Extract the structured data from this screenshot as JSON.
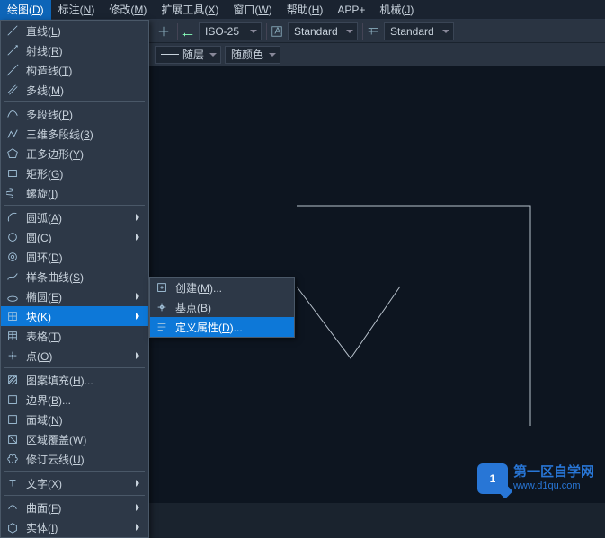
{
  "menubar": [
    {
      "label": "绘图",
      "key": "D",
      "active": true
    },
    {
      "label": "标注",
      "key": "N"
    },
    {
      "label": "修改",
      "key": "M"
    },
    {
      "label": "扩展工具",
      "key": "X"
    },
    {
      "label": "窗口",
      "key": "W"
    },
    {
      "label": "帮助",
      "key": "H"
    },
    {
      "label": "APP+",
      "key": ""
    },
    {
      "label": "机械",
      "key": "J"
    }
  ],
  "toolbar1": {
    "sel1": "ISO-25",
    "sel2": "Standard",
    "sel3": "Standard"
  },
  "toolbar2": {
    "sel1": "随层",
    "sel2": "随颜色"
  },
  "draw_menu": [
    {
      "icon": "line",
      "label": "直线",
      "sk": "L"
    },
    {
      "icon": "ray",
      "label": "射线",
      "sk": "R"
    },
    {
      "icon": "xline",
      "label": "构造线",
      "sk": "T"
    },
    {
      "icon": "mline",
      "label": "多线",
      "sk": "M"
    },
    {
      "sep": true
    },
    {
      "icon": "pline",
      "label": "多段线",
      "sk": "P"
    },
    {
      "icon": "3dpoly",
      "label": "三维多段线",
      "sk": "3"
    },
    {
      "icon": "polygon",
      "label": "正多边形",
      "sk": "Y"
    },
    {
      "icon": "rect",
      "label": "矩形",
      "sk": "G"
    },
    {
      "icon": "helix",
      "label": "螺旋",
      "sk": "I"
    },
    {
      "sep": true
    },
    {
      "icon": "arc",
      "label": "圆弧",
      "sk": "A",
      "sub": true
    },
    {
      "icon": "circle",
      "label": "圆",
      "sk": "C",
      "sub": true
    },
    {
      "icon": "donut",
      "label": "圆环",
      "sk": "D"
    },
    {
      "icon": "spline",
      "label": "样条曲线",
      "sk": "S"
    },
    {
      "icon": "ellipse",
      "label": "椭圆",
      "sk": "E",
      "sub": true
    },
    {
      "icon": "block",
      "label": "块",
      "sk": "K",
      "sub": true,
      "hl": true
    },
    {
      "icon": "table",
      "label": "表格",
      "sk": "T"
    },
    {
      "icon": "point",
      "label": "点",
      "sk": "O",
      "sub": true
    },
    {
      "sep": true
    },
    {
      "icon": "hatch",
      "label": "图案填充",
      "sk": "H",
      "dots": true
    },
    {
      "icon": "boundary",
      "label": "边界",
      "sk": "B",
      "dots": true
    },
    {
      "icon": "region",
      "label": "面域",
      "sk": "N"
    },
    {
      "icon": "wipeout",
      "label": "区域覆盖",
      "sk": "W"
    },
    {
      "icon": "revcloud",
      "label": "修订云线",
      "sk": "U"
    },
    {
      "sep": true
    },
    {
      "icon": "text",
      "label": "文字",
      "sk": "X",
      "sub": true
    },
    {
      "sep": true
    },
    {
      "icon": "surface",
      "label": "曲面",
      "sk": "F",
      "sub": true
    },
    {
      "icon": "solid",
      "label": "实体",
      "sk": "I",
      "sub": true
    }
  ],
  "block_submenu": [
    {
      "icon": "make",
      "label": "创建",
      "sk": "M",
      "dots": true
    },
    {
      "icon": "base",
      "label": "基点",
      "sk": "B"
    },
    {
      "icon": "attdef",
      "label": "定义属性",
      "sk": "D",
      "dots": true,
      "hl": true
    }
  ],
  "watermark": {
    "badge": "1",
    "line1": "第一区自学网",
    "line2": "www.d1qu.com"
  }
}
